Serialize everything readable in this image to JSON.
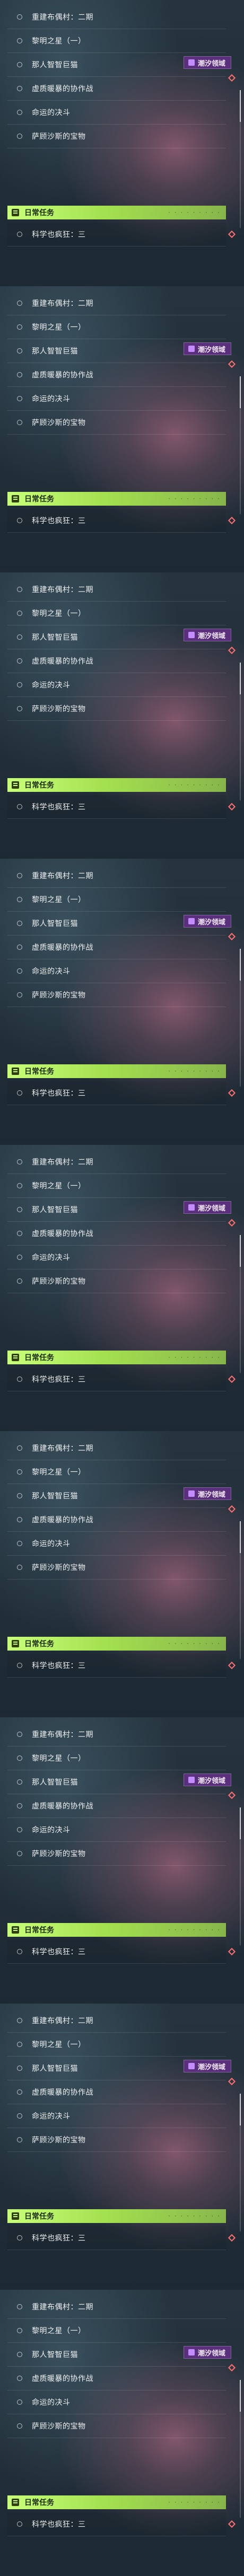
{
  "panels": [
    {
      "quests": [
        "重建布偶村：二期",
        "黎明之星（一）",
        "那人智智巨猫",
        "虚质暖暴的协作战",
        "命运的决斗",
        "萨顾沙斯的宝物"
      ],
      "event_badge": "潮汐领域",
      "daily_title": "日常任务",
      "daily_quest": "科学也疯狂：三",
      "daily_dots": "· · · · · · · · ·"
    },
    {
      "quests": [
        "重建布偶村：二期",
        "黎明之星（一）",
        "那人智智巨猫",
        "虚质暖暴的协作战",
        "命运的决斗",
        "萨顾沙斯的宝物"
      ],
      "event_badge": "潮汐领域",
      "daily_title": "日常任务",
      "daily_quest": "科学也疯狂：三",
      "daily_dots": "· · · · · · · · ·"
    },
    {
      "quests": [
        "重建布偶村：二期",
        "黎明之星（一）",
        "那人智智巨猫",
        "虚质暖暴的协作战",
        "命运的决斗",
        "萨顾沙斯的宝物"
      ],
      "event_badge": "潮汐领域",
      "daily_title": "日常任务",
      "daily_quest": "科学也疯狂：三",
      "daily_dots": "· · · · · · · · ·"
    },
    {
      "quests": [
        "重建布偶村：二期",
        "黎明之星（一）",
        "那人智智巨猫",
        "虚质暖暴的协作战",
        "命运的决斗",
        "萨顾沙斯的宝物"
      ],
      "event_badge": "潮汐领域",
      "daily_title": "日常任务",
      "daily_quest": "科学也疯狂：三",
      "daily_dots": "· · · · · · · · ·"
    },
    {
      "quests": [
        "重建布偶村：二期",
        "黎明之星（一）",
        "那人智智巨猫",
        "虚质暖暴的协作战",
        "命运的决斗",
        "萨顾沙斯的宝物"
      ],
      "event_badge": "潮汐领域",
      "daily_title": "日常任务",
      "daily_quest": "科学也疯狂：三",
      "daily_dots": "· · · · · · · · ·"
    },
    {
      "quests": [
        "重建布偶村：二期",
        "黎明之星（一）",
        "那人智智巨猫",
        "虚质暖暴的协作战",
        "命运的决斗",
        "萨顾沙斯的宝物"
      ],
      "event_badge": "潮汐领域",
      "daily_title": "日常任务",
      "daily_quest": "科学也疯狂：三",
      "daily_dots": "· · · · · · · · ·"
    },
    {
      "quests": [
        "重建布偶村：二期",
        "黎明之星（一）",
        "那人智智巨猫",
        "虚质暖暴的协作战",
        "命运的决斗",
        "萨顾沙斯的宝物"
      ],
      "event_badge": "潮汐领域",
      "daily_title": "日常任务",
      "daily_quest": "科学也疯狂：三",
      "daily_dots": "· · · · · · · · ·"
    },
    {
      "quests": [
        "重建布偶村：二期",
        "黎明之星（一）",
        "那人智智巨猫",
        "虚质暖暴的协作战",
        "命运的决斗",
        "萨顾沙斯的宝物"
      ],
      "event_badge": "潮汐领域",
      "daily_title": "日常任务",
      "daily_quest": "科学也疯狂：三",
      "daily_dots": "· · · · · · · · ·"
    },
    {
      "quests": [
        "重建布偶村：二期",
        "黎明之星（一）",
        "那人智智巨猫",
        "虚质暖暴的协作战",
        "命运的决斗",
        "萨顾沙斯的宝物"
      ],
      "event_badge": "潮汐领域",
      "daily_title": "日常任务",
      "daily_quest": "科学也疯狂：三",
      "daily_dots": "· · · · · · · · ·"
    }
  ],
  "icons": {
    "daily": "calendar-icon",
    "badge": "event-icon",
    "diamond": "diamond-icon"
  },
  "colors": {
    "daily_header": "#a3e04f",
    "event_badge": "#5a2f7b",
    "diamond": "#ff6f6f"
  }
}
